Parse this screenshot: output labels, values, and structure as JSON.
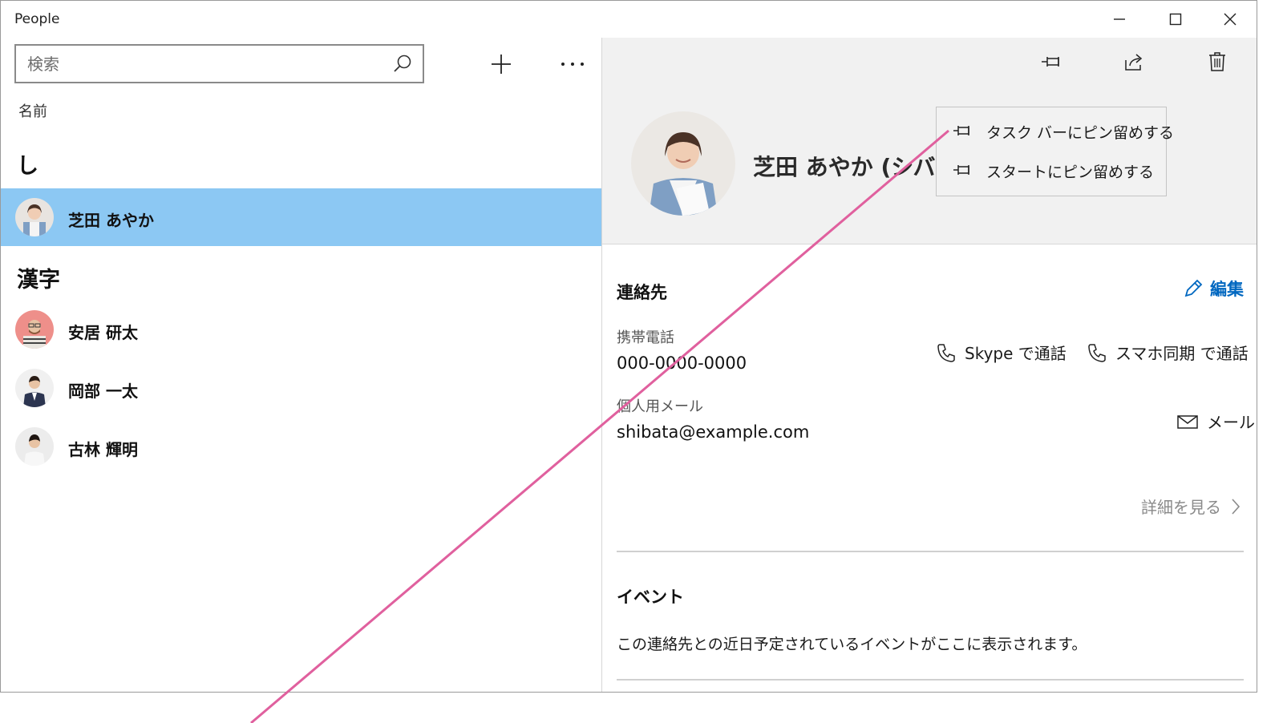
{
  "titlebar": {
    "title": "People",
    "minimize_icon": "minimize-icon",
    "maximize_icon": "maximize-icon",
    "close_icon": "close-icon"
  },
  "list_pane": {
    "search": {
      "placeholder": "検索",
      "value": ""
    },
    "column_header": "名前",
    "groups": [
      {
        "heading": "し",
        "contacts": [
          {
            "name": "芝田 あやか",
            "selected": true
          }
        ]
      },
      {
        "heading": "漢字",
        "contacts": [
          {
            "name": "安居 研太",
            "selected": false
          },
          {
            "name": "岡部 一太",
            "selected": false
          },
          {
            "name": "古林 輝明",
            "selected": false
          }
        ]
      }
    ]
  },
  "detail_pane": {
    "name": "芝田 あやか (シバタ",
    "pin_menu": [
      {
        "label": "タスク バーにピン留めする"
      },
      {
        "label": "スタートにピン留めする"
      }
    ],
    "contact_section": {
      "title": "連絡先",
      "edit_label": "編集",
      "phone_label": "携帯電話",
      "phone_value": "000-0000-0000",
      "skype_call": "Skype で通話",
      "phone_link_call": "スマホ同期 で通話",
      "email_label": "個人用メール",
      "email_value": "shibata@example.com",
      "mail_action": "メール",
      "see_more": "詳細を見る"
    },
    "events_section": {
      "title": "イベント",
      "empty_text": "この連絡先との近日予定されているイベントがここに表示されます。"
    }
  },
  "colors": {
    "selection": "#8cc8f3",
    "accent": "#0067c0",
    "pane_bg": "#f1f1f1",
    "annotation_line": "#e0609e"
  }
}
